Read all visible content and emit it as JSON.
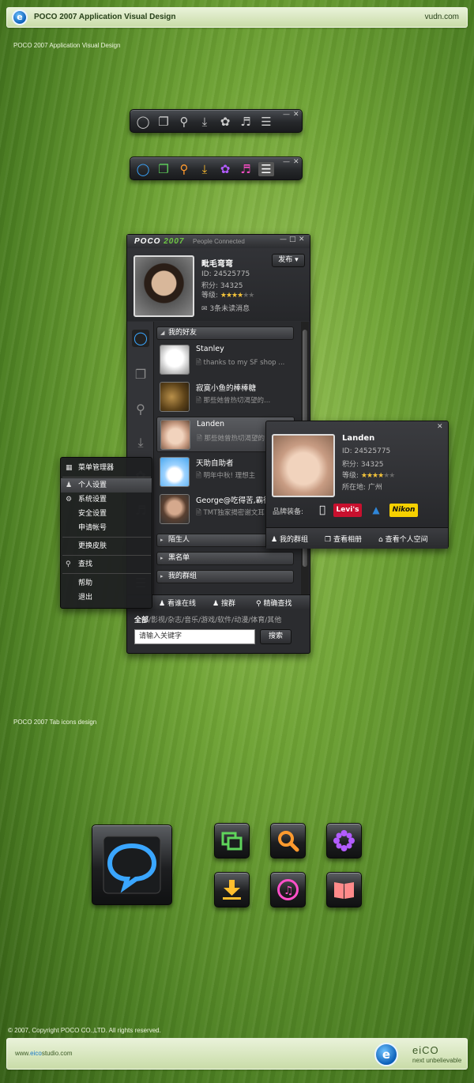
{
  "header": {
    "title": "POCO 2007 Application Visual Design",
    "url": "vudn.com"
  },
  "caption_top": "POCO 2007 Application Visual Design",
  "caption_tabs": "POCO 2007 Tab icons design",
  "toolbar_icons": [
    "chat-bubble-icon",
    "windows-icon",
    "search-icon",
    "download-icon",
    "flower-icon",
    "music-icon",
    "notepad-icon"
  ],
  "window": {
    "brand": "POCO",
    "brand_year": "2007",
    "brand_sub": "People Connected",
    "profile": {
      "name": "毗毛弯弯",
      "id": "ID: 24525775",
      "points": "积分: 34325",
      "level_label": "等级:",
      "level_stars": 4,
      "max_stars": 6,
      "messages": "3条未读消息",
      "publish_btn": "发布"
    },
    "groups": {
      "friends": "我的好友",
      "strangers": "陌生人",
      "blacklist": "黑名单",
      "my_groups": "我的群组"
    },
    "friends": [
      {
        "name": "Stanley",
        "msg": "thanks to my SF shop ..."
      },
      {
        "name": "寂寞小鱼的棒棒糖",
        "msg": "那些她曾热切渴望的..."
      },
      {
        "name": "Landen",
        "msg": "那些她曾热切渴望的..."
      },
      {
        "name": "天助自助者",
        "msg": "明年中秋! 理想主"
      },
      {
        "name": "George@吃得苦,霸得",
        "msg": "TMT独家揭密谢文耳"
      }
    ],
    "bottombar": {
      "online": "看谁在线",
      "search_group": "搜群",
      "precise": "精确查找"
    },
    "categories": {
      "all": "全部",
      "rest": "/影视/杂志/音乐/游戏/软件/动漫/体育/其他"
    },
    "search_placeholder": "请输入关键字",
    "search_btn": "搜索"
  },
  "popup": {
    "name": "Landen",
    "id": "ID: 24525775",
    "points": "积分: 34325",
    "level_label": "等级:",
    "level_stars": 4,
    "location": "所在地: 广州",
    "brands_label": "品牌装备:",
    "brand_logos": [
      "apple-logo",
      "levis-logo",
      "adidas-logo",
      "nikon-logo"
    ],
    "brand_levis": "Levi's",
    "brand_nikon": "Nikon",
    "btn_groups": "我的群组",
    "btn_album": "查看相册",
    "btn_space": "查看个人空间"
  },
  "menu": {
    "items": [
      "菜单管理器",
      "个人设置",
      "系统设置",
      "安全设置",
      "申请帐号",
      "更换皮肤",
      "查找",
      "帮助",
      "退出"
    ]
  },
  "tab_icons": [
    "chat-bubble-icon",
    "windows-icon",
    "search-icon",
    "flower-icon",
    "download-icon",
    "music-icon",
    "book-icon"
  ],
  "footer": {
    "copyright": "© 2007, Copyright POCO CO.,LTD. All rights reserved.",
    "url_prefix": "www.",
    "url_highlight": "eico",
    "url_suffix": "studio.com",
    "brand": "eiCO",
    "tagline": "next unbelievable"
  },
  "colors": {
    "accent_green": "#6fc644",
    "accent_blue": "#3aa6ff",
    "star": "#f3c33b"
  }
}
